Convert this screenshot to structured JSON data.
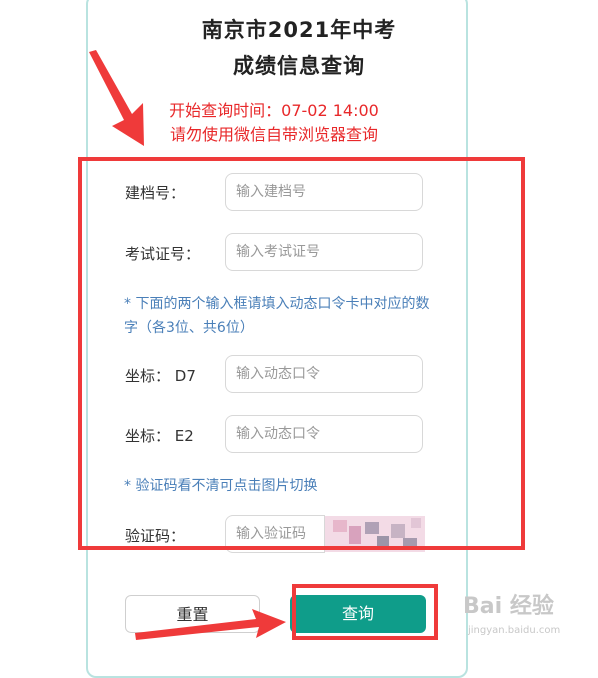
{
  "header": {
    "title_line1": "南京市2021年中考",
    "title_line2": "成绩信息查询"
  },
  "notice": {
    "line1": "开始查询时间：07-02 14:00",
    "line2": "请勿使用微信自带浏览器查询"
  },
  "form": {
    "archive_label": "建档号：",
    "archive_placeholder": "输入建档号",
    "exam_label": "考试证号：",
    "exam_placeholder": "输入考试证号",
    "hint_token": "* 下面的两个输入框请填入动态口令卡中对应的数字（各3位、共6位）",
    "coord1_label": "坐标： D7",
    "coord1_placeholder": "输入动态口令",
    "coord2_label": "坐标： E2",
    "coord2_placeholder": "输入动态口令",
    "hint_captcha": "* 验证码看不清可点击图片切换",
    "captcha_label": "验证码：",
    "captcha_placeholder": "输入验证码"
  },
  "buttons": {
    "reset_label": "重置",
    "query_label": "查询"
  },
  "watermark": {
    "text": "Bai 经验",
    "sub": "jingyan.baidu.com"
  },
  "colors": {
    "accent": "#0f9d8a",
    "notice_red": "#e8282a",
    "annotation_red": "#ef3a3a",
    "hint_blue": "#4a7fb8"
  }
}
